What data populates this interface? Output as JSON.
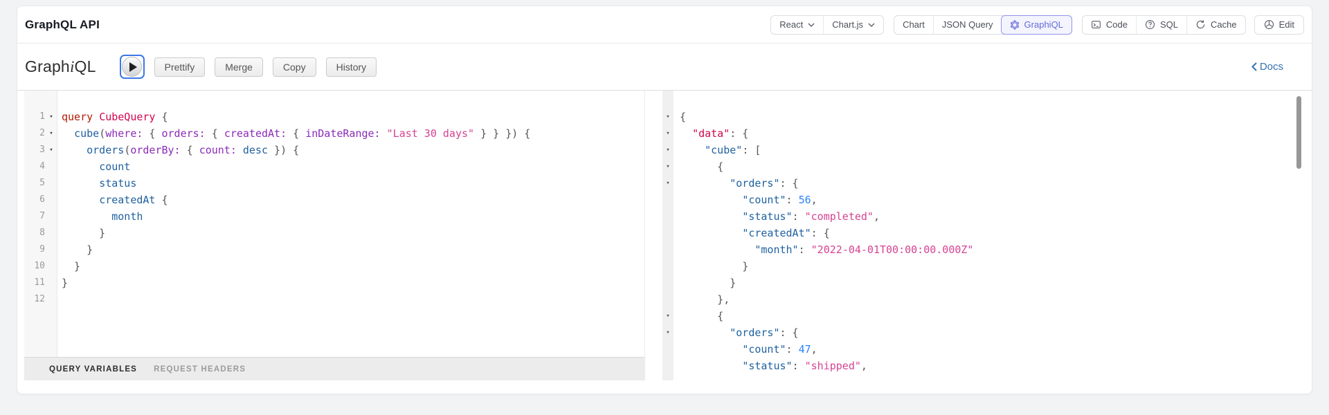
{
  "header": {
    "title": "GraphQL API",
    "framework_select": {
      "label": "React"
    },
    "chart_select": {
      "label": "Chart.js"
    },
    "view_tabs": [
      {
        "label": "Chart",
        "selected": false,
        "icon": null
      },
      {
        "label": "JSON Query",
        "selected": false,
        "icon": null
      },
      {
        "label": "GraphiQL",
        "selected": true,
        "icon": "graphql-logo"
      }
    ],
    "actions": [
      {
        "label": "Code",
        "icon": "terminal"
      },
      {
        "label": "SQL",
        "icon": "question-circle"
      },
      {
        "label": "Cache",
        "icon": "refresh"
      }
    ],
    "edit_button": {
      "label": "Edit",
      "icon": "cube"
    }
  },
  "toolbar": {
    "logo_part1": "Graph",
    "logo_part2": "i",
    "logo_part3": "QL",
    "buttons": [
      "Prettify",
      "Merge",
      "Copy",
      "History"
    ],
    "docs_label": "Docs"
  },
  "variables_bar": {
    "tabs": [
      {
        "label": "QUERY VARIABLES",
        "active": true
      },
      {
        "label": "REQUEST HEADERS",
        "active": false
      }
    ]
  },
  "colors": {
    "accent_purple": "#666bd9",
    "docs_blue": "#3572b0",
    "syntax": {
      "keyword": "#B11A04",
      "def": "#D2054E",
      "property": "#1F61A0",
      "attribute": "#8B2BB9",
      "string": "#D64292",
      "number": "#2882F9",
      "punctuation": "#555555"
    }
  },
  "editor": {
    "lines": [
      {
        "num": "1",
        "fold": true,
        "tokens": [
          [
            "query ",
            "k"
          ],
          [
            "CubeQuery ",
            "d"
          ],
          [
            "{",
            "t"
          ]
        ]
      },
      {
        "num": "2",
        "fold": true,
        "tokens": [
          [
            "  ",
            "t"
          ],
          [
            "cube",
            "p"
          ],
          [
            "(",
            "t"
          ],
          [
            "where:",
            "a"
          ],
          [
            " { ",
            "t"
          ],
          [
            "orders:",
            "a"
          ],
          [
            " { ",
            "t"
          ],
          [
            "createdAt:",
            "a"
          ],
          [
            " { ",
            "t"
          ],
          [
            "inDateRange:",
            "a"
          ],
          [
            " ",
            "t"
          ],
          [
            "\"Last 30 days\"",
            "s"
          ],
          [
            " } } }) {",
            "t"
          ]
        ]
      },
      {
        "num": "3",
        "fold": true,
        "tokens": [
          [
            "    ",
            "t"
          ],
          [
            "orders",
            "p"
          ],
          [
            "(",
            "t"
          ],
          [
            "orderBy:",
            "a"
          ],
          [
            " { ",
            "t"
          ],
          [
            "count:",
            "a"
          ],
          [
            " ",
            "t"
          ],
          [
            "desc",
            "p"
          ],
          [
            " }) {",
            "t"
          ]
        ]
      },
      {
        "num": "4",
        "fold": false,
        "tokens": [
          [
            "      ",
            "t"
          ],
          [
            "count",
            "p"
          ]
        ]
      },
      {
        "num": "5",
        "fold": false,
        "tokens": [
          [
            "      ",
            "t"
          ],
          [
            "status",
            "p"
          ]
        ]
      },
      {
        "num": "6",
        "fold": false,
        "tokens": [
          [
            "      ",
            "t"
          ],
          [
            "createdAt",
            "p"
          ],
          [
            " {",
            "t"
          ]
        ]
      },
      {
        "num": "7",
        "fold": false,
        "tokens": [
          [
            "        ",
            "t"
          ],
          [
            "month",
            "p"
          ]
        ]
      },
      {
        "num": "8",
        "fold": false,
        "tokens": [
          [
            "      }",
            "t"
          ]
        ]
      },
      {
        "num": "9",
        "fold": false,
        "tokens": [
          [
            "    }",
            "t"
          ]
        ]
      },
      {
        "num": "10",
        "fold": false,
        "tokens": [
          [
            "  }",
            "t"
          ]
        ]
      },
      {
        "num": "11",
        "fold": false,
        "tokens": [
          [
            "}",
            "t"
          ]
        ]
      },
      {
        "num": "12",
        "fold": false,
        "tokens": []
      }
    ]
  },
  "response": {
    "lines": [
      {
        "fold": true,
        "tokens": [
          [
            "{",
            "t"
          ]
        ]
      },
      {
        "fold": true,
        "tokens": [
          [
            "  ",
            "t"
          ],
          [
            "\"data\"",
            "d"
          ],
          [
            ": {",
            "t"
          ]
        ]
      },
      {
        "fold": true,
        "tokens": [
          [
            "    ",
            "t"
          ],
          [
            "\"cube\"",
            "p"
          ],
          [
            ": [",
            "t"
          ]
        ]
      },
      {
        "fold": true,
        "tokens": [
          [
            "      {",
            "t"
          ]
        ]
      },
      {
        "fold": true,
        "tokens": [
          [
            "        ",
            "t"
          ],
          [
            "\"orders\"",
            "p"
          ],
          [
            ": {",
            "t"
          ]
        ]
      },
      {
        "fold": false,
        "tokens": [
          [
            "          ",
            "t"
          ],
          [
            "\"count\"",
            "p"
          ],
          [
            ": ",
            "t"
          ],
          [
            "56",
            "n"
          ],
          [
            ",",
            "t"
          ]
        ]
      },
      {
        "fold": false,
        "tokens": [
          [
            "          ",
            "t"
          ],
          [
            "\"status\"",
            "p"
          ],
          [
            ": ",
            "t"
          ],
          [
            "\"completed\"",
            "s"
          ],
          [
            ",",
            "t"
          ]
        ]
      },
      {
        "fold": false,
        "tokens": [
          [
            "          ",
            "t"
          ],
          [
            "\"createdAt\"",
            "p"
          ],
          [
            ": {",
            "t"
          ]
        ]
      },
      {
        "fold": false,
        "tokens": [
          [
            "            ",
            "t"
          ],
          [
            "\"month\"",
            "p"
          ],
          [
            ": ",
            "t"
          ],
          [
            "\"2022-04-01T00:00:00.000Z\"",
            "s"
          ]
        ]
      },
      {
        "fold": false,
        "tokens": [
          [
            "          }",
            "t"
          ]
        ]
      },
      {
        "fold": false,
        "tokens": [
          [
            "        }",
            "t"
          ]
        ]
      },
      {
        "fold": false,
        "tokens": [
          [
            "      },",
            "t"
          ]
        ]
      },
      {
        "fold": true,
        "tokens": [
          [
            "      {",
            "t"
          ]
        ]
      },
      {
        "fold": true,
        "tokens": [
          [
            "        ",
            "t"
          ],
          [
            "\"orders\"",
            "p"
          ],
          [
            ": {",
            "t"
          ]
        ]
      },
      {
        "fold": false,
        "tokens": [
          [
            "          ",
            "t"
          ],
          [
            "\"count\"",
            "p"
          ],
          [
            ": ",
            "t"
          ],
          [
            "47",
            "n"
          ],
          [
            ",",
            "t"
          ]
        ]
      },
      {
        "fold": false,
        "tokens": [
          [
            "          ",
            "t"
          ],
          [
            "\"status\"",
            "p"
          ],
          [
            ": ",
            "t"
          ],
          [
            "\"shipped\"",
            "s"
          ],
          [
            ",",
            "t"
          ]
        ]
      }
    ]
  }
}
